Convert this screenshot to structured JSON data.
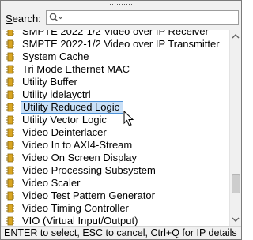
{
  "search": {
    "label": "Search:",
    "placeholder": "",
    "value": ""
  },
  "list": {
    "items": [
      {
        "label": "SMPTE 2022-1/2 Video over IP Receiver",
        "selected": false
      },
      {
        "label": "SMPTE 2022-1/2 Video over IP Transmitter",
        "selected": false
      },
      {
        "label": "System Cache",
        "selected": false
      },
      {
        "label": "Tri Mode Ethernet MAC",
        "selected": false
      },
      {
        "label": "Utility Buffer",
        "selected": false
      },
      {
        "label": "Utility idelayctrl",
        "selected": false
      },
      {
        "label": "Utility Reduced Logic",
        "selected": true
      },
      {
        "label": "Utility Vector Logic",
        "selected": false
      },
      {
        "label": "Video Deinterlacer",
        "selected": false
      },
      {
        "label": "Video In to AXI4-Stream",
        "selected": false
      },
      {
        "label": "Video On Screen Display",
        "selected": false
      },
      {
        "label": "Video Processing Subsystem",
        "selected": false
      },
      {
        "label": "Video Scaler",
        "selected": false
      },
      {
        "label": "Video Test Pattern Generator",
        "selected": false
      },
      {
        "label": "Video Timing Controller",
        "selected": false
      },
      {
        "label": "VIO (Virtual Input/Output)",
        "selected": false
      }
    ],
    "scroll_thumb_position": 0.86,
    "scroll_thumb_size": 0.1
  },
  "status": {
    "text": "ENTER to select, ESC to cancel, Ctrl+Q for IP details"
  },
  "icons": {
    "ip_icon": "ip-core-icon",
    "search": "search-icon"
  },
  "colors": {
    "selection_bg": "#c9e0f7",
    "selection_border": "#4a8fd6",
    "icon_gold": "#d9a521"
  }
}
